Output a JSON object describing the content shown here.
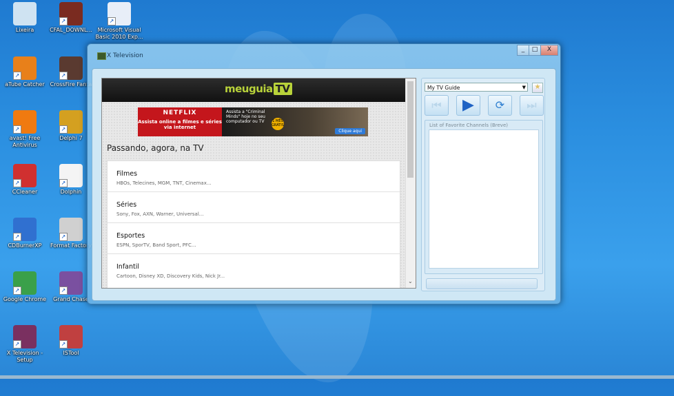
{
  "desktop": {
    "icons": [
      {
        "label": "Lixeira",
        "icon": "recycle-bin-icon",
        "color": "#cfe3f2"
      },
      {
        "label": "CFAL_DOWNL...",
        "icon": "crossfire-icon",
        "color": "#7a2b20"
      },
      {
        "label": "Microsoft Visual Basic 2010 Exp...",
        "icon": "visual-basic-icon",
        "color": "#e8eef8"
      },
      {
        "label": "aTube Catcher",
        "icon": "atube-catcher-icon",
        "color": "#e8801a"
      },
      {
        "label": "CrossFire Fanta",
        "icon": "crossfire-icon",
        "color": "#5a3a30"
      },
      {
        "label": "avast! Free Antivirus",
        "icon": "avast-icon",
        "color": "#f07a10"
      },
      {
        "label": "Delphi 7",
        "icon": "delphi-icon",
        "color": "#d4a020"
      },
      {
        "label": "CCleaner",
        "icon": "ccleaner-icon",
        "color": "#d03030"
      },
      {
        "label": "Dolphin",
        "icon": "dolphin-icon",
        "color": "#f4f4f4"
      },
      {
        "label": "CDBurnerXP",
        "icon": "cdburnerxp-icon",
        "color": "#3070d0"
      },
      {
        "label": "Format Factory",
        "icon": "format-factory-icon",
        "color": "#d0d0d0"
      },
      {
        "label": "Google Chrome",
        "icon": "chrome-icon",
        "color": "#3aa04a"
      },
      {
        "label": "Grand Chase",
        "icon": "grand-chase-icon",
        "color": "#7a50a0"
      },
      {
        "label": "X Television - Setup",
        "icon": "winrar-icon",
        "color": "#7a3060"
      },
      {
        "label": "ISTool",
        "icon": "istool-icon",
        "color": "#c04040"
      }
    ]
  },
  "window": {
    "title": "X Television",
    "minimize": "_",
    "maximize": "□",
    "close": "X"
  },
  "site": {
    "logo_main": "meuguia",
    "logo_tv": "TV",
    "banner": {
      "brand": "NETFLIX",
      "headline": "Assista online a filmes e séries via internet",
      "promo_text": "Assista a \"Criminal Minds\" hoje no seu computador ou TV",
      "badge": "1 MÊS GRÁTIS",
      "cta": "Clique aqui"
    },
    "heading": "Passando, agora, na TV",
    "categories": [
      {
        "title": "Filmes",
        "subtitle": "HBOs, Telecines, MGM, TNT, Cinemax..."
      },
      {
        "title": "Séries",
        "subtitle": "Sony, Fox, AXN, Warner, Universal..."
      },
      {
        "title": "Esportes",
        "subtitle": "ESPN, SporTV, Band Sport, PFC..."
      },
      {
        "title": "Infantil",
        "subtitle": "Cartoon, Disney XD, Discovery Kids, Nick Jr..."
      }
    ]
  },
  "panel": {
    "guide_select": "My TV Guide",
    "favorites_label": "List of Favorite Channels (Breve)"
  }
}
